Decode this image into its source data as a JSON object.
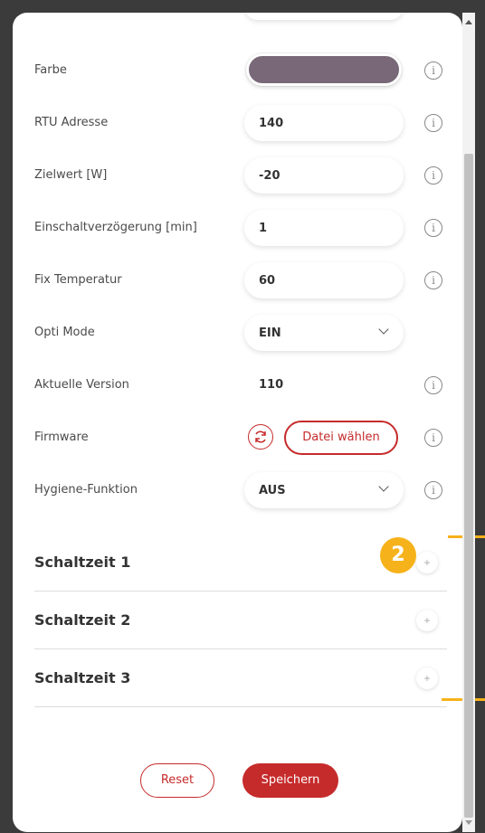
{
  "form": {
    "color": {
      "label": "Farbe",
      "swatch": "#786878"
    },
    "rtu": {
      "label": "RTU Adresse",
      "value": "140"
    },
    "target": {
      "label": "Zielwert [W]",
      "value": "-20"
    },
    "delay": {
      "label": "Einschaltverzögerung [min]",
      "value": "1"
    },
    "fix_temp": {
      "label": "Fix Temperatur",
      "value": "60"
    },
    "opti": {
      "label": "Opti Mode",
      "value": "EIN"
    },
    "version": {
      "label": "Aktuelle Version",
      "value": "110"
    },
    "firmware": {
      "label": "Firmware",
      "file_button": "Datei wählen"
    },
    "hygiene": {
      "label": "Hygiene-Funktion",
      "value": "AUS"
    },
    "info_glyph": "i"
  },
  "sections": [
    {
      "title": "Schaltzeit 1",
      "add": "+"
    },
    {
      "title": "Schaltzeit 2",
      "add": "+"
    },
    {
      "title": "Schaltzeit 3",
      "add": "+"
    }
  ],
  "annotation": {
    "badge": "2",
    "color": "#f6b21a"
  },
  "actions": {
    "reset": "Reset",
    "save": "Speichern",
    "accent": "#c62b2b"
  }
}
